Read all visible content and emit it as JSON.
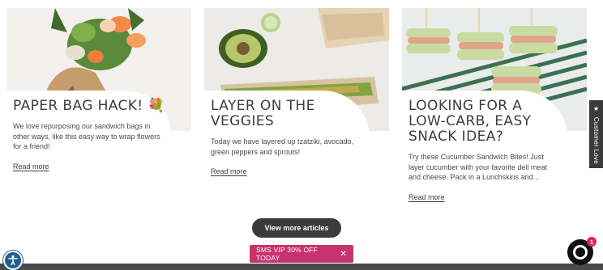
{
  "articles": [
    {
      "title": "PAPER BAG HACK! 💐",
      "excerpt": "We love repurposing our sandwich bags in other ways, like this easy way to wrap flowers for a friend!",
      "read_more": "Read more",
      "image": "flowers-in-paper-bag"
    },
    {
      "title": "LAYER ON THE VEGGIES",
      "excerpt": "Today we have layered up tzatziki, avocado, green peppers and sprouts!",
      "read_more": "Read more",
      "image": "veggie-sandwich"
    },
    {
      "title": "LOOKING FOR A LOW-CARB, EASY SNACK IDEA?",
      "excerpt": "Try these Cucumber Sandwich Bites! Just layer cucumber with your favorite deli meat and cheese. Pack in a Lunchskins and...",
      "read_more": "Read more",
      "image": "cucumber-sandwich-bites"
    }
  ],
  "view_more_label": "View more articles",
  "sms_banner": {
    "text": "SMS VIP 30% OFF TODAY",
    "close": "✕"
  },
  "side_tab": {
    "label": "Customer Love",
    "icon": "★"
  },
  "chat": {
    "badge_count": "1"
  },
  "colors": {
    "accent_pink": "#c8336f",
    "dark": "#3b3b3b",
    "a11y_blue": "#1f5f8f"
  }
}
